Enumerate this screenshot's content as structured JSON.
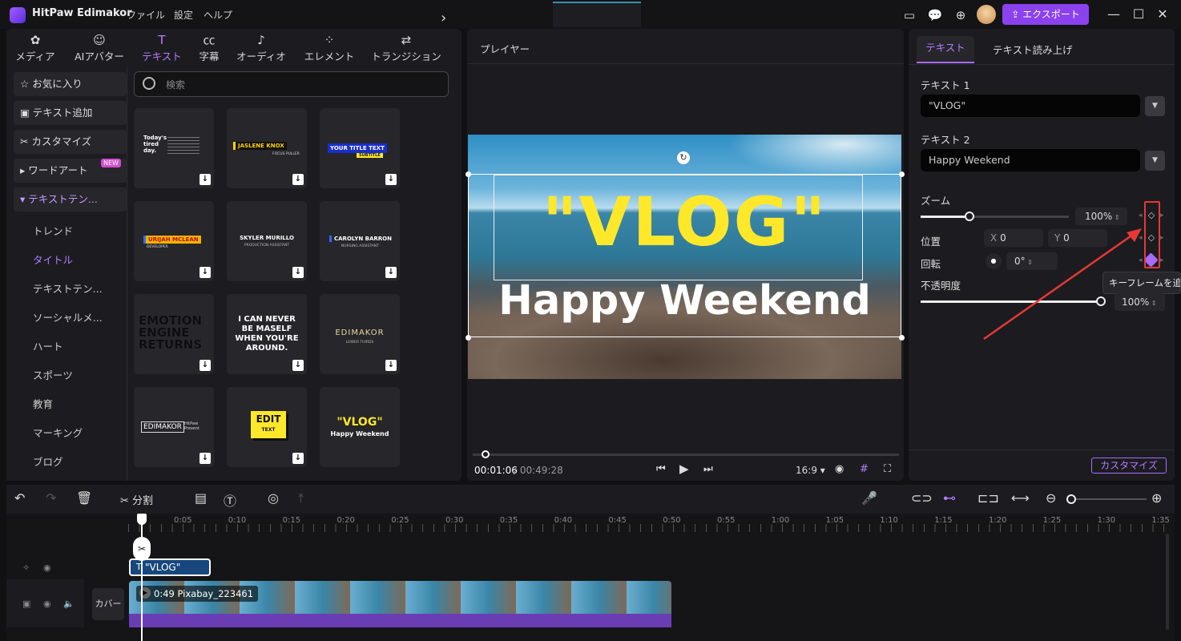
{
  "app": {
    "name": "HitPaw Edimakor",
    "menus": [
      "ファイル",
      "設定",
      "ヘルプ"
    ],
    "export_label": "エクスポート"
  },
  "toolbar": {
    "items": [
      "メディア",
      "AIアバター",
      "テキスト",
      "字幕",
      "オーディオ",
      "エレメント",
      "トランジション"
    ],
    "active": "テキスト"
  },
  "sidebar": {
    "items": [
      {
        "label": "お気に入り",
        "icon": "star-icon"
      },
      {
        "label": "テキスト追加",
        "icon": "add-text-icon"
      },
      {
        "label": "カスタマイズ",
        "icon": "customize-icon"
      },
      {
        "label": "ワードアート",
        "icon": "triangle-right-icon",
        "badge": "NEW"
      },
      {
        "label": "テキストテン...",
        "icon": "triangle-down-icon"
      }
    ],
    "subitems": [
      "トレンド",
      "タイトル",
      "テキストテン...",
      "ソーシャルメ...",
      "ハート",
      "スポーツ",
      "教育",
      "マーキング",
      "ブログ"
    ],
    "selected_sub": "タイトル"
  },
  "search": {
    "placeholder": "検索"
  },
  "templates": [
    {
      "lines": [
        "Today's",
        "tired",
        "day."
      ],
      "style": "white-small"
    },
    {
      "lines": [
        "JASLENE KNOX",
        "FOCUS PULLER"
      ],
      "style": "yellow-bar"
    },
    {
      "lines": [
        "YOUR TITLE TEXT",
        "SUBTITLE"
      ],
      "style": "blue-box"
    },
    {
      "lines": [
        "URIJAH MCLEAN",
        "DEVELOPER"
      ],
      "style": "orange-bar"
    },
    {
      "lines": [
        "SKYLER MURILLO",
        "PRODUCTION ASSISTANT"
      ],
      "style": "white-center"
    },
    {
      "lines": [
        "CAROLYN BARRON",
        "NURSING ASSISTANT"
      ],
      "style": "blue-mark"
    },
    {
      "lines": [
        "EMOTION",
        "ENGINE",
        "RETURNS"
      ],
      "style": "dark-bold"
    },
    {
      "lines": [
        "I CAN NEVER",
        "BE MASELF",
        "WHEN YOU'RE",
        "AROUND."
      ],
      "style": "white-bold"
    },
    {
      "lines": [
        "EDIMAKOR",
        "LOWER THIRDS"
      ],
      "style": "gold"
    },
    {
      "lines": [
        "EDIMAKOR",
        "HitPaw Present"
      ],
      "style": "boxed"
    },
    {
      "lines": [
        "EDIT",
        "TEXT"
      ],
      "style": "yellow-square"
    },
    {
      "lines": [
        "\"VLOG\"",
        "Happy Weekend"
      ],
      "style": "vlog"
    }
  ],
  "player": {
    "label": "プレイヤー",
    "title_text": "\"VLOG\"",
    "subtitle_text": "Happy Weekend",
    "current_time": "00:01:06",
    "total_time": "/ 00:49:28",
    "aspect": "16:9",
    "progress": 0.02
  },
  "props": {
    "tabs": [
      "テキスト",
      "テキスト読み上げ"
    ],
    "text1_label": "テキスト 1",
    "text1_value": "\"VLOG\"",
    "text2_label": "テキスト 2",
    "text2_value": "Happy Weekend",
    "zoom_label": "ズーム",
    "zoom_value": "100%",
    "zoom_level": 0.33,
    "position_label": "位置",
    "x_label": "X",
    "x_value": "0",
    "y_label": "Y",
    "y_value": "0",
    "rotation_label": "回転",
    "rotation_value": "0°",
    "opacity_label": "不透明度",
    "opacity_value": "100%",
    "opacity_level": 1.0,
    "tooltip": "キーフレームを追加",
    "customize_label": "カスタマイズ",
    "highlight_color": "#e53935"
  },
  "timeline": {
    "split_label": "分割",
    "ticks": [
      "0:05",
      "0:10",
      "0:15",
      "0:20",
      "0:25",
      "0:30",
      "0:35",
      "0:40",
      "0:45",
      "0:50",
      "0:55",
      "1:00",
      "1:05",
      "1:10",
      "1:15",
      "1:20",
      "1:25",
      "1:30",
      "1:35"
    ],
    "text_clip": "\"VLOG\"",
    "cover_label": "カバー",
    "video_clip": "0:49 Pixabay_223461"
  },
  "colors": {
    "accent": "#8b42ee",
    "accent_text": "#b57bff",
    "title_yellow": "#ffe82a"
  }
}
